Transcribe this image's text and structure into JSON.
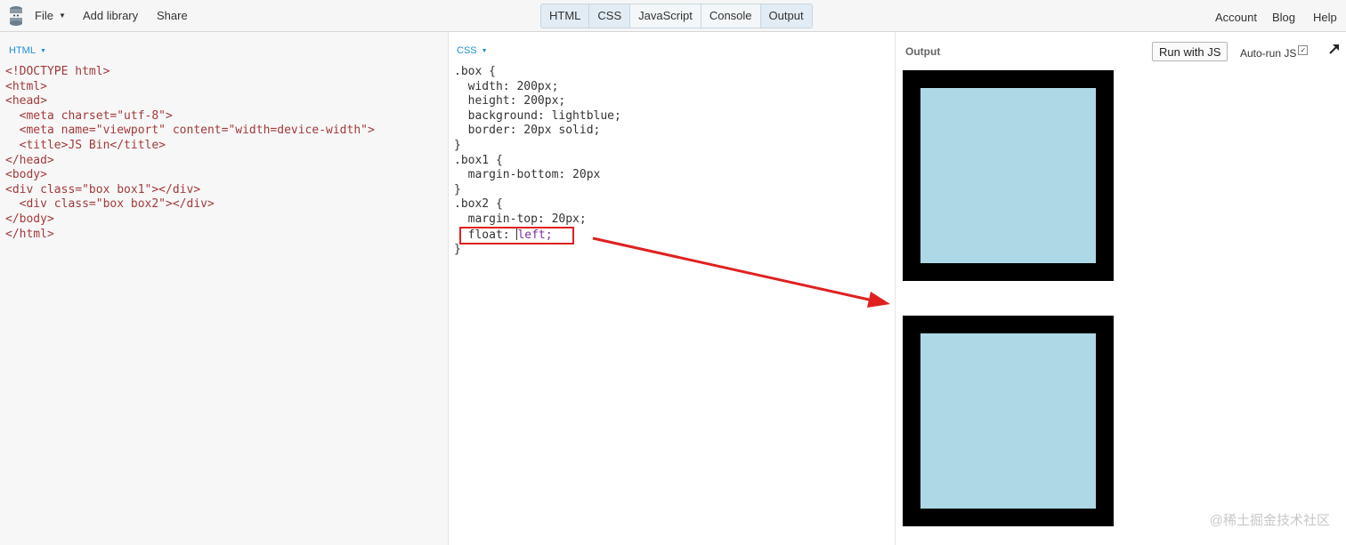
{
  "topbar": {
    "menu": {
      "file": "File",
      "add_library": "Add library",
      "share": "Share"
    },
    "tabs": [
      "HTML",
      "CSS",
      "JavaScript",
      "Console",
      "Output"
    ],
    "right_menu": {
      "account": "Account",
      "blog": "Blog",
      "help": "Help"
    }
  },
  "html_panel": {
    "label": "HTML",
    "lines": {
      "l1": "<!DOCTYPE html>",
      "l2": "<html>",
      "l3": "<head>",
      "l4": "  <meta charset=\"utf-8\">",
      "l5": "  <meta name=\"viewport\" content=\"width=device-width\">",
      "l6": "  <title>JS Bin</title>",
      "l7": "</head>",
      "l8": "<body>",
      "l9": "<div class=\"box box1\"></div>",
      "l10": "  <div class=\"box box2\"></div>",
      "l11": "</body>",
      "l12": "</html>"
    }
  },
  "css_panel": {
    "label": "CSS",
    "lines": {
      "l1": ".box {",
      "l2": "  width: 200px;",
      "l3": "  height: 200px;",
      "l4": "  background: lightblue;",
      "l5": "  border: 20px solid;",
      "l6": "}",
      "l7": ".box1 {",
      "l8": "  margin-bottom: 20px",
      "l9": "}",
      "l10": ".box2 {",
      "l11": "  margin-top: 20px;",
      "l12a": "  float: ",
      "l12b": "left;",
      "l13": "}"
    }
  },
  "output_panel": {
    "label": "Output",
    "run_button": "Run with JS",
    "autorun_label": "Auto-run JS",
    "autorun_checked": true,
    "box_fill_color": "#add8e6",
    "box_border_color": "#000000"
  },
  "annotation_color": "#e02020",
  "watermark": "@稀土掘金技术社区"
}
